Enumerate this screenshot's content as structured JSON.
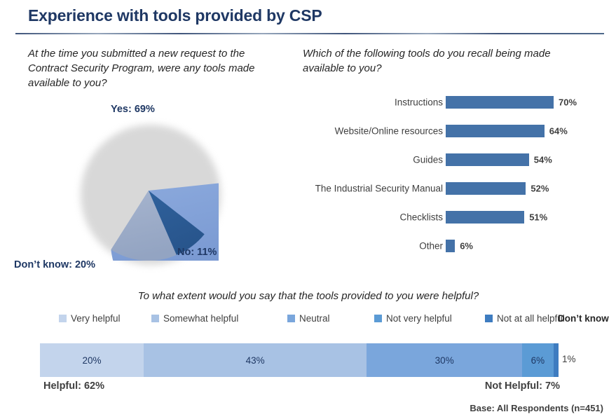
{
  "header": {
    "title": "Experience with tools provided by CSP",
    "accent_color": "#1F3864"
  },
  "pie_panel": {
    "question": "At the time you submitted a new request to the Contract Security Program, were any tools made available to you?",
    "labels": {
      "yes": "Yes: 69%",
      "no": "No: 11%",
      "dont_know": "Don’t know: 20%"
    }
  },
  "bars_panel": {
    "question": "Which of the following tools do you recall being made available to you?"
  },
  "stack_panel": {
    "question": "To what extent would you say that the tools provided to you were helpful?",
    "legend": [
      {
        "label": "Very helpful",
        "color": "#C3D4EC",
        "swatch": true
      },
      {
        "label": "Somewhat helpful",
        "color": "#A8C2E4",
        "swatch": true
      },
      {
        "label": "Neutral",
        "color": "#7AA6DC",
        "swatch": true
      },
      {
        "label": "Not very helpful",
        "color": "#5B9BD5",
        "swatch": true
      },
      {
        "label": "Not at all helpful",
        "color": "#3E7CC0",
        "swatch": true
      },
      {
        "label": "Don’t know",
        "color": "#404040",
        "swatch": false
      }
    ],
    "outside_label": "1%",
    "note_helpful": "Helpful: 62%",
    "note_not_helpful": "Not Helpful: 7%"
  },
  "footer": {
    "base": "Base: All Respondents (n=451)"
  },
  "chart_data": [
    {
      "type": "pie",
      "title": "At the time you submitted a new request to the Contract Security Program, were any tools made available to you?",
      "categories": [
        "Yes",
        "No",
        "Don’t know"
      ],
      "values": [
        69,
        11,
        20
      ],
      "labels": [
        "Yes: 69%",
        "No: 11%",
        "Don’t know: 20%"
      ],
      "colors": [
        "#7D9DD4",
        "#2E5E99",
        "#9AAAC8"
      ],
      "unit": "%",
      "legend": "data-labels",
      "start_angle_deg": -6
    },
    {
      "type": "bar",
      "orientation": "horizontal",
      "title": "Which of the following tools do you recall being made available to you?",
      "categories": [
        "Instructions",
        "Website/Online resources",
        "Guides",
        "The Industrial Security Manual",
        "Checklists",
        "Other"
      ],
      "values": [
        70,
        64,
        54,
        52,
        51,
        6
      ],
      "value_labels": [
        "70%",
        "64%",
        "54%",
        "52%",
        "51%",
        "6%"
      ],
      "color": "#4472A8",
      "xlabel": "",
      "ylabel": "",
      "xlim": [
        0,
        100
      ],
      "grid": false,
      "unit": "%"
    },
    {
      "type": "bar",
      "orientation": "horizontal",
      "stacked": true,
      "title": "To what extent would you say that the tools provided to you were helpful?",
      "categories": [
        "Very helpful",
        "Somewhat helpful",
        "Neutral",
        "Not very helpful",
        "Not at all helpful",
        "Don’t know"
      ],
      "values": [
        20,
        43,
        30,
        6,
        0,
        1
      ],
      "value_labels": [
        "20%",
        "43%",
        "30%",
        "6%",
        "",
        "1%"
      ],
      "colors": [
        "#C3D4EC",
        "#A8C2E4",
        "#7AA6DC",
        "#5B9BD5",
        "#3E7CC0",
        "#3E7CC0"
      ],
      "annotations": [
        "Helpful: 62%",
        "Not Helpful: 7%"
      ],
      "xlim": [
        0,
        100
      ],
      "grid": false,
      "unit": "%"
    }
  ]
}
